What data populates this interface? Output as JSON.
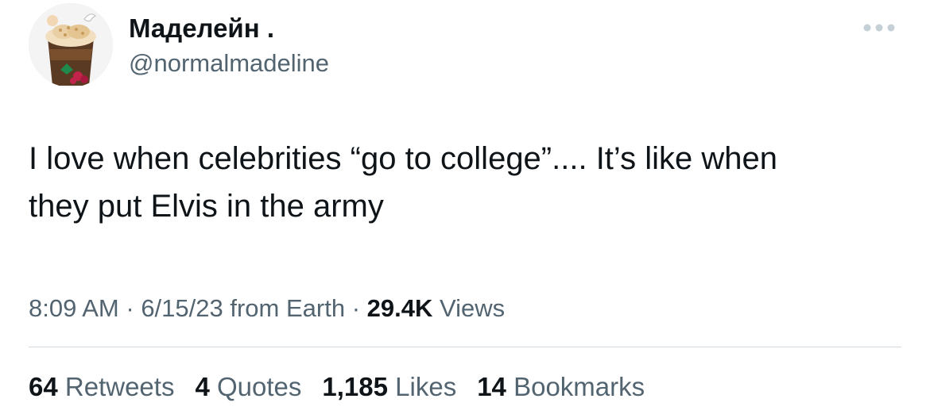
{
  "tweet": {
    "author": {
      "display_name": "Маделейн .",
      "handle": "@normalmadeline",
      "avatar_icon": "iced-coffee-cup-icon"
    },
    "more_icon": "more-dots-icon",
    "text_line1": "I love when celebrities “go to college”.... It’s like when",
    "text_line2": "they put Elvis in the army",
    "meta": {
      "time": "8:09 AM",
      "sep1": " · ",
      "date": "6/15/23",
      "source": " from Earth",
      "sep2": " · ",
      "views_count": "29.4K",
      "views_label": " Views"
    },
    "stats": [
      {
        "count": "64",
        "label": " Retweets"
      },
      {
        "count": "4",
        "label": " Quotes"
      },
      {
        "count": "1,185",
        "label": " Likes"
      },
      {
        "count": "14",
        "label": " Bookmarks"
      }
    ],
    "colors": {
      "primary_text": "#0f1419",
      "secondary_text": "#536471",
      "divider": "#cfd9de"
    }
  }
}
